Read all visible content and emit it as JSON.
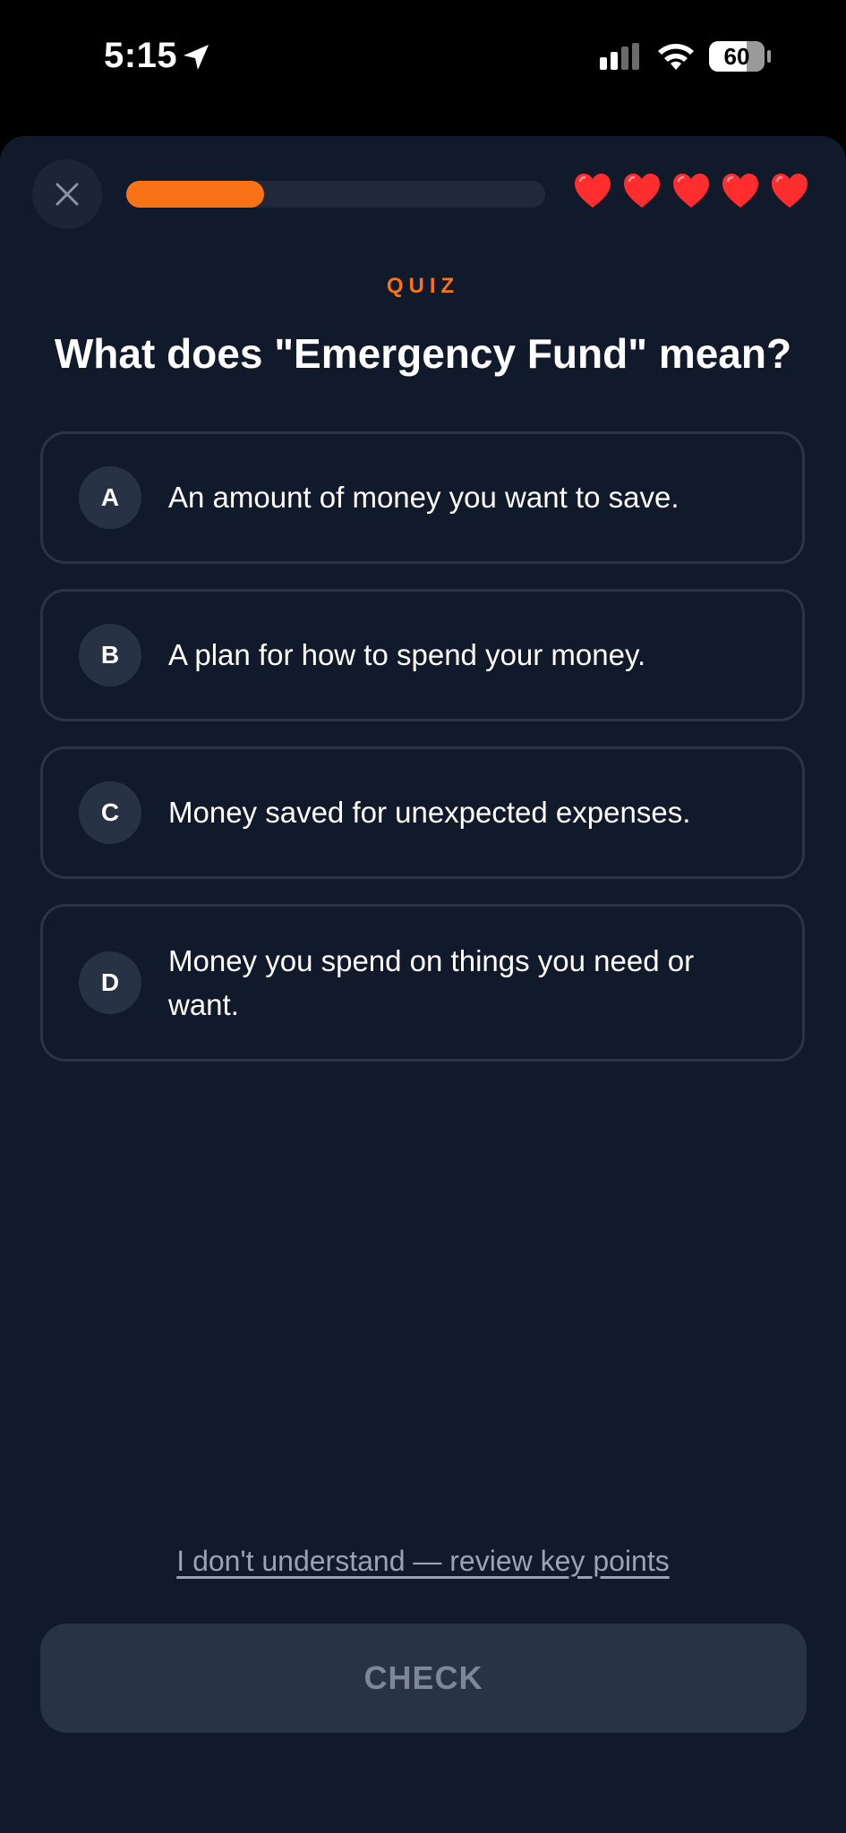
{
  "status_bar": {
    "time": "5:15",
    "battery_level": "60",
    "icons": [
      "location-arrow-icon",
      "cellular-signal-icon",
      "wifi-icon",
      "battery-icon"
    ]
  },
  "header": {
    "close_icon": "close-icon",
    "progress_fraction": 0.33,
    "hearts_count": 5,
    "heart_color": "#ff2d2d"
  },
  "quiz": {
    "label": "QUIZ",
    "question": "What does \"Emergency Fund\" mean?",
    "options": [
      {
        "letter": "A",
        "text": "An amount of money you want to save."
      },
      {
        "letter": "B",
        "text": "A plan for how to spend your money."
      },
      {
        "letter": "C",
        "text": "Money saved for unexpected expenses."
      },
      {
        "letter": "D",
        "text": "Money you spend on things you need or want."
      }
    ]
  },
  "footer": {
    "review_link": "I don't understand — review key points",
    "check_label": "CHECK"
  },
  "colors": {
    "accent": "#f97316",
    "background": "#111a2b",
    "option_border": "#2a3445",
    "button_disabled": "#283345"
  }
}
